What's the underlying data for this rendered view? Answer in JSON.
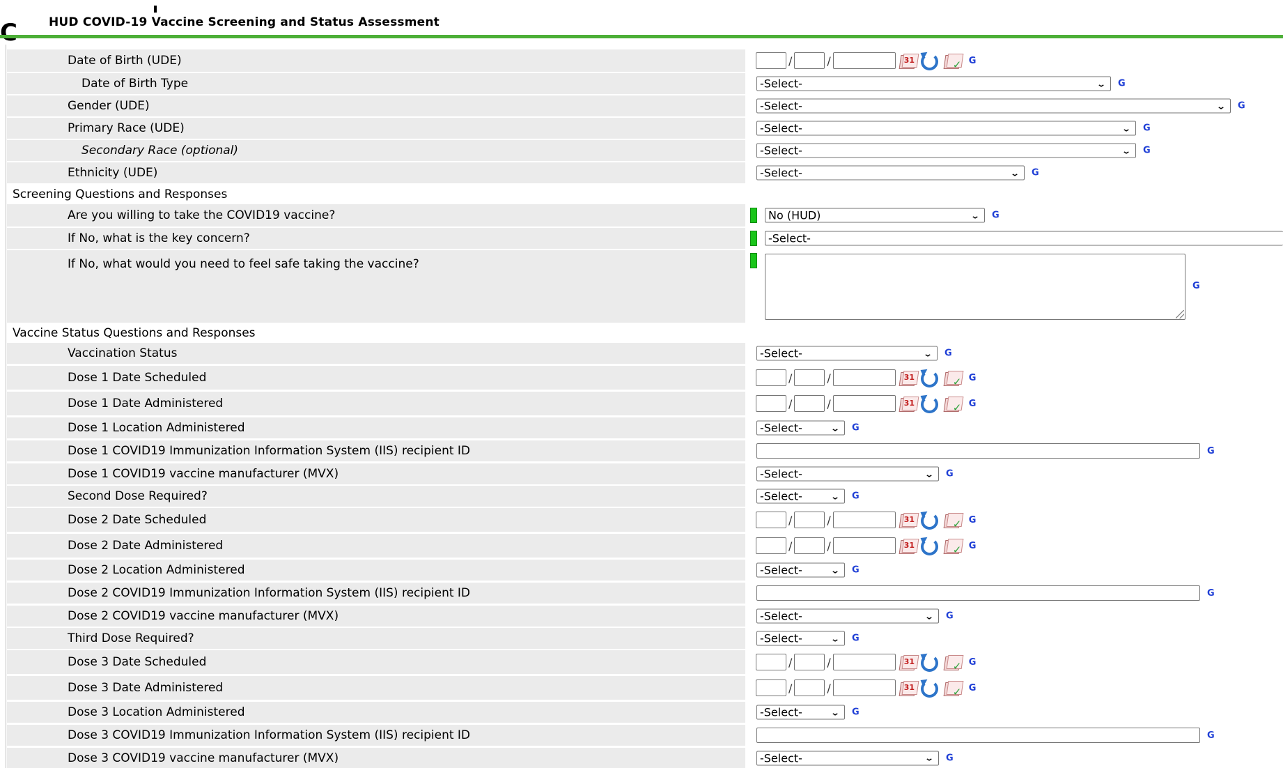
{
  "form": {
    "title": "HUD COVID-19 Vaccine Screening and Status Assessment"
  },
  "glyphs": {
    "corner": "C",
    "green_indicator_color": "#19c51a",
    "accent_rule_color": "#4caf37",
    "history_link": "G"
  },
  "date_row_icons": [
    "calendar-icon",
    "refresh-icon",
    "calendar-check-icon"
  ],
  "date_row_icon_texts": {
    "calendar": "31",
    "check": "✓"
  },
  "rows": {
    "dob": {
      "label": "Date of Birth (UDE)"
    },
    "dob_type": {
      "label": "Date of Birth Type",
      "value": "-Select-"
    },
    "gender": {
      "label": "Gender (UDE)",
      "value": "-Select-"
    },
    "primary_race": {
      "label": "Primary Race (UDE)",
      "value": "-Select-"
    },
    "secondary_race": {
      "label": "Secondary Race (optional)",
      "value": "-Select-"
    },
    "ethnicity": {
      "label": "Ethnicity (UDE)",
      "value": "-Select-"
    },
    "screening_section": {
      "label": "Screening Questions and Responses"
    },
    "willing": {
      "label": "Are you willing to take the COVID19 vaccine?",
      "value": "No (HUD)"
    },
    "key_concern": {
      "label": "If No, what is the key concern?",
      "value": "-Select-"
    },
    "feel_safe": {
      "label": "If No, what would you need to feel safe taking the vaccine?",
      "value": ""
    },
    "status_section": {
      "label": "Vaccine Status Questions and Responses"
    },
    "vacc_status": {
      "label": "Vaccination Status",
      "value": "-Select-"
    },
    "d1_sched": {
      "label": "Dose 1 Date Scheduled"
    },
    "d1_admin": {
      "label": "Dose 1 Date Administered"
    },
    "d1_loc": {
      "label": "Dose 1 Location Administered",
      "value": "-Select-"
    },
    "d1_iis": {
      "label": "Dose 1 COVID19 Immunization Information System (IIS) recipient ID",
      "value": ""
    },
    "d1_mvx": {
      "label": "Dose 1 COVID19 vaccine manufacturer (MVX)",
      "value": "-Select-"
    },
    "second_req": {
      "label": "Second Dose Required?",
      "value": "-Select-"
    },
    "d2_sched": {
      "label": "Dose 2 Date Scheduled"
    },
    "d2_admin": {
      "label": "Dose 2 Date Administered"
    },
    "d2_loc": {
      "label": "Dose 2 Location Administered",
      "value": "-Select-"
    },
    "d2_iis": {
      "label": "Dose 2 COVID19 Immunization Information System (IIS) recipient ID",
      "value": ""
    },
    "d2_mvx": {
      "label": "Dose 2 COVID19 vaccine manufacturer (MVX)",
      "value": "-Select-"
    },
    "third_req": {
      "label": "Third Dose Required?",
      "value": "-Select-"
    },
    "d3_sched": {
      "label": "Dose 3 Date Scheduled"
    },
    "d3_admin": {
      "label": "Dose 3 Date Administered"
    },
    "d3_loc": {
      "label": "Dose 3 Location Administered",
      "value": "-Select-"
    },
    "d3_iis": {
      "label": "Dose 3 COVID19 Immunization Information System (IIS) recipient ID",
      "value": ""
    },
    "d3_mvx": {
      "label": "Dose 3 COVID19 vaccine manufacturer (MVX)",
      "value": "-Select-"
    }
  }
}
